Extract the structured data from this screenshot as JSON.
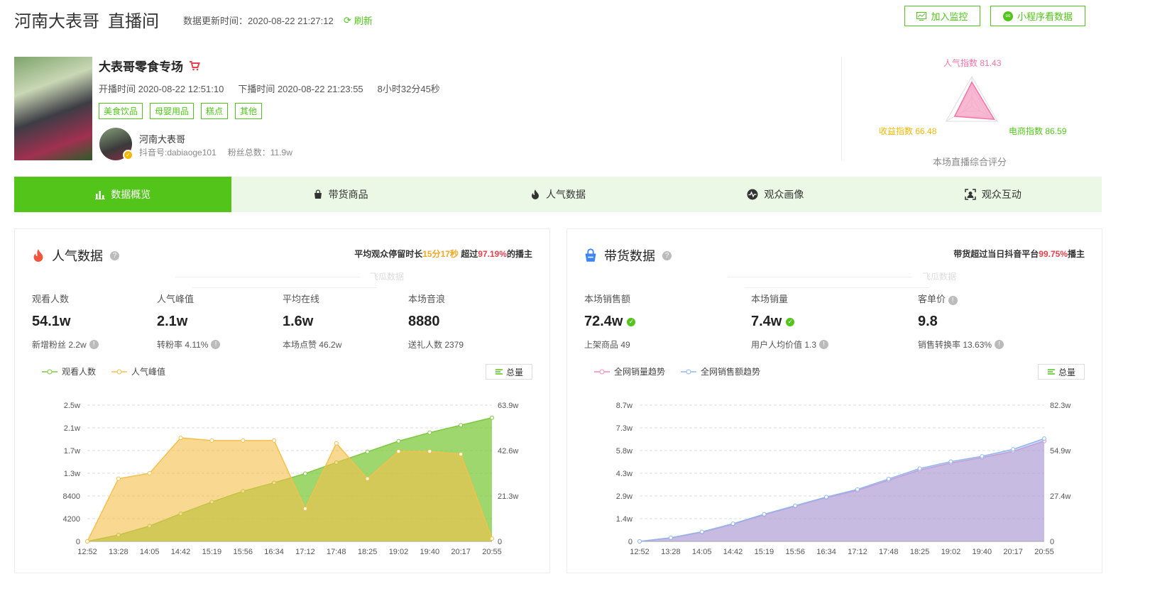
{
  "header": {
    "anchor_name": "河南大表哥",
    "page_name": "直播间",
    "update_label": "数据更新时间：2020-08-22 21:27:12",
    "refresh_label": "刷新",
    "monitor_btn": "加入监控",
    "mini_btn": "小程序看数据"
  },
  "live": {
    "title": "大表哥零食专场",
    "start": "开播时间 2020-08-22 12:51:10",
    "end": "下播时间 2020-08-22 21:23:55",
    "duration": "8小时32分45秒",
    "tags": [
      "美食饮品",
      "母婴用品",
      "糕点",
      "其他"
    ],
    "anchor_name": "河南大表哥",
    "douyin_id": "抖音号:dabiaoge101",
    "fans": "粉丝总数：11.9w"
  },
  "score": {
    "popularity": "人气指数 81.43",
    "income": "收益指数 66.48",
    "ecommerce": "电商指数 86.59",
    "caption": "本场直播综合评分",
    "values": {
      "popularity": 81.43,
      "ecommerce": 86.59,
      "income": 66.48
    }
  },
  "tabs": [
    {
      "label": "数据概览",
      "icon": "bar-chart-icon",
      "active": true
    },
    {
      "label": "带货商品",
      "icon": "shopping-bag-icon",
      "active": false
    },
    {
      "label": "人气数据",
      "icon": "fire-icon",
      "active": false
    },
    {
      "label": "观众画像",
      "icon": "pulse-icon",
      "active": false
    },
    {
      "label": "观众互动",
      "icon": "face-scan-icon",
      "active": false
    }
  ],
  "popularity": {
    "title": "人气数据",
    "summary_prefix": "平均观众停留时长",
    "summary_time": "15分17秒",
    "summary_mid": " 超过",
    "summary_pct": "97.19%",
    "summary_suffix": "的播主",
    "watermark": "飞瓜数据",
    "stats": [
      {
        "label": "观看人数",
        "value": "54.1w",
        "sub": "新增粉丝 2.2w"
      },
      {
        "label": "人气峰值",
        "value": "2.1w",
        "sub": "转粉率 4.11%"
      },
      {
        "label": "平均在线",
        "value": "1.6w",
        "sub": "本场点赞 46.2w"
      },
      {
        "label": "本场音浪",
        "value": "8880",
        "sub": "送礼人数 2379"
      }
    ],
    "legend": [
      "观看人数",
      "人气峰值"
    ],
    "total_btn": "总量"
  },
  "sales": {
    "title": "带货数据",
    "summary_prefix": "带货超过当日抖音平台",
    "summary_pct": "99.75%",
    "summary_suffix": "播主",
    "watermark": "飞瓜数据",
    "stats": [
      {
        "label": "本场销售额",
        "value": "72.4w",
        "sub": "上架商品 49"
      },
      {
        "label": "本场销量",
        "value": "7.4w",
        "sub": "用户人均价值 1.3"
      },
      {
        "label": "客单价",
        "value": "9.8",
        "sub": "销售转换率 13.63%"
      }
    ],
    "legend": [
      "全网销量趋势",
      "全网销售额趋势"
    ],
    "total_btn": "总量"
  },
  "chart_data": [
    {
      "type": "area",
      "x": [
        "12:52",
        "13:28",
        "14:05",
        "14:42",
        "15:19",
        "15:56",
        "16:34",
        "17:12",
        "17:48",
        "18:25",
        "19:02",
        "19:40",
        "20:17",
        "20:55"
      ],
      "left_axis_ticks": [
        "0",
        "4200",
        "8400",
        "1.3w",
        "1.7w",
        "2.1w",
        "2.5w"
      ],
      "right_axis_ticks": [
        "0",
        "21.3w",
        "42.6w",
        "63.9w"
      ],
      "ylim_left": [
        0,
        25000
      ],
      "ylim_right": [
        0,
        639000
      ],
      "series": [
        {
          "name": "观看人数",
          "axis": "right",
          "color": "#7cc93e",
          "values": [
            0,
            30000,
            72000,
            130000,
            185000,
            235000,
            275000,
            318000,
            370000,
            420000,
            470000,
            510000,
            545000,
            580000
          ]
        },
        {
          "name": "人气峰值",
          "axis": "left",
          "color": "#f5c04a",
          "values": [
            0,
            11500,
            12500,
            19000,
            18500,
            18500,
            18500,
            6000,
            18000,
            11500,
            16500,
            16500,
            16000,
            500
          ]
        }
      ]
    },
    {
      "type": "area",
      "x": [
        "12:52",
        "13:28",
        "14:05",
        "14:42",
        "15:19",
        "15:56",
        "16:34",
        "17:12",
        "17:48",
        "18:25",
        "19:02",
        "19:40",
        "20:17",
        "20:55"
      ],
      "left_axis_ticks": [
        "0",
        "1.4w",
        "2.9w",
        "4.3w",
        "5.8w",
        "7.3w",
        "8.7w"
      ],
      "right_axis_ticks": [
        "0",
        "27.4w",
        "54.9w",
        "82.3w"
      ],
      "ylim_left": [
        0,
        87000
      ],
      "ylim_right": [
        0,
        823000
      ],
      "series": [
        {
          "name": "全网销量趋势",
          "axis": "left",
          "color": "#f08cb5",
          "values": [
            0,
            2200,
            5800,
            11000,
            17000,
            22500,
            28000,
            32500,
            39000,
            45500,
            50000,
            53500,
            57500,
            64000
          ]
        },
        {
          "name": "全网销售额趋势",
          "axis": "right",
          "color": "#8fb6f2",
          "values": [
            0,
            22000,
            58000,
            107000,
            164000,
            216000,
            268000,
            314000,
            377000,
            440000,
            482000,
            514000,
            556000,
            621000
          ]
        }
      ]
    }
  ]
}
